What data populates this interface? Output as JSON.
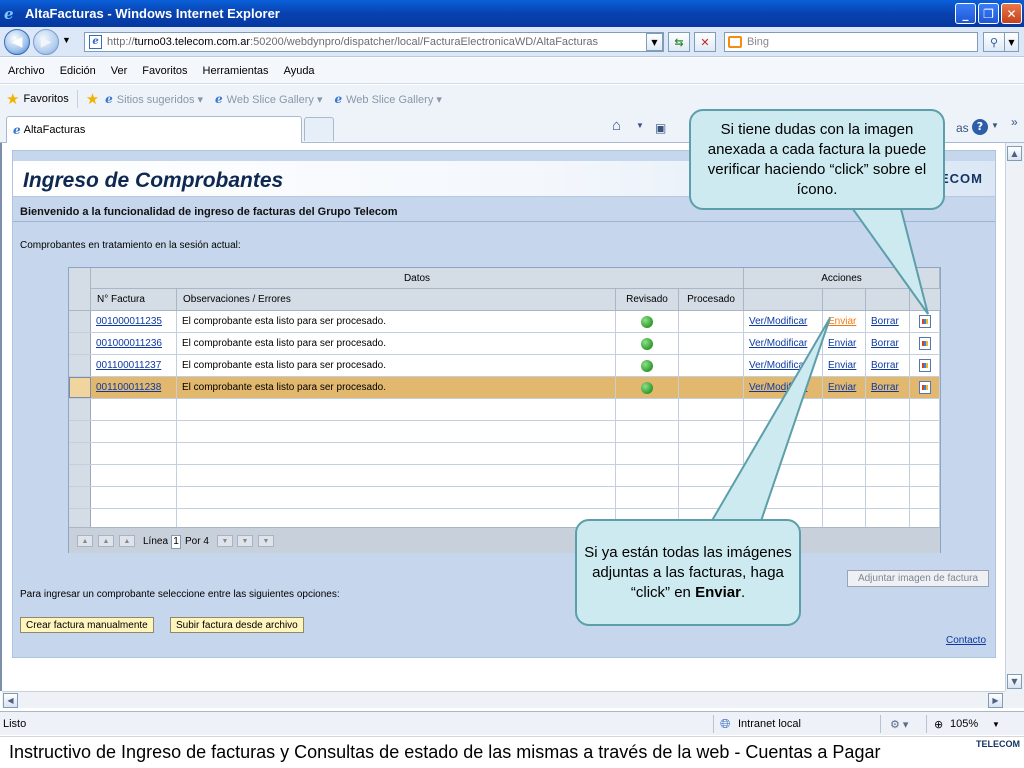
{
  "window": {
    "title": "AltaFacturas - Windows Internet Explorer"
  },
  "address": {
    "url_prefix": "http://",
    "url_host": "turno03.telecom.com.ar",
    "url_rest": ":50200/webdynpro/dispatcher/local/FacturaElectronicaWD/AltaFacturas",
    "search_placeholder": "Bing"
  },
  "menu": [
    "Archivo",
    "Edición",
    "Ver",
    "Favoritos",
    "Herramientas",
    "Ayuda"
  ],
  "favbar": {
    "favorites": "Favoritos",
    "items": [
      "Sitios sugeridos ▾",
      "Web Slice Gallery ▾",
      "Web Slice Gallery ▾"
    ]
  },
  "tab": {
    "title": "AltaFacturas",
    "tools_tail": "as ▾"
  },
  "page": {
    "title": "Ingreso de Comprobantes",
    "brand": "ECOM",
    "welcome": "Bienvenido a la funcionalidad de ingreso de facturas del Grupo Telecom",
    "tratamiento": "Comprobantes en tratamiento en la sesión actual:",
    "opciones": "Para ingresar un comprobante seleccione entre las siguientes opciones:",
    "btn_manual": "Crear factura manualmente",
    "btn_archivo": "Subir factura desde archivo",
    "btn_adjuntar": "Adjuntar imagen de factura",
    "contacto": "Contacto"
  },
  "table": {
    "group_datos": "Datos",
    "group_acciones": "Acciones",
    "columns": [
      "N° Factura",
      "Observaciones / Errores",
      "Revisado",
      "Procesado"
    ],
    "rows": [
      {
        "factura": "001000011235",
        "obs": "El comprobante esta listo para ser procesado.",
        "revisado": true,
        "ver": "Ver/Modificar",
        "enviar": "Enviar",
        "borrar": "Borrar"
      },
      {
        "factura": "001000011236",
        "obs": "El comprobante esta listo para ser procesado.",
        "revisado": true,
        "ver": "Ver/Modificar",
        "enviar": "Enviar",
        "borrar": "Borrar"
      },
      {
        "factura": "001100011237",
        "obs": "El comprobante esta listo para ser procesado.",
        "revisado": true,
        "ver": "Ver/Modificar",
        "enviar": "Enviar",
        "borrar": "Borrar"
      },
      {
        "factura": "001100011238",
        "obs": "El comprobante esta listo para ser procesado.",
        "revisado": true,
        "ver": "Ver/Modificar",
        "enviar": "Enviar",
        "borrar": "Borrar",
        "selected": true
      }
    ],
    "empty_rows": 6,
    "pager": {
      "linea": "Línea",
      "value": "1",
      "por": "Por 4"
    }
  },
  "callouts": {
    "top": "Si tiene dudas con la imagen anexada a cada factura la puede verificar haciendo “click” sobre el ícono.",
    "bottom_pre": "Si ya están todas las imágenes adjuntas a las facturas, haga “click” en ",
    "bottom_bold": "Enviar",
    "bottom_post": "."
  },
  "status": {
    "text": "Listo",
    "zone": "Intranet local",
    "zoom": "105%"
  },
  "footer": {
    "text": "Instructivo de Ingreso de facturas y Consultas de estado de las mismas a través de la web    -    Cuentas a Pagar",
    "logo": "TELECOM"
  }
}
